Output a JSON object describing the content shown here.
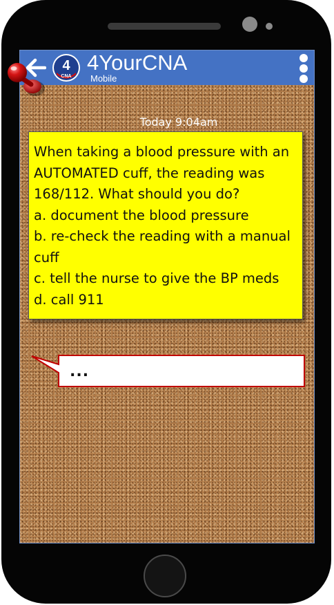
{
  "app": {
    "title": "4YourCNA",
    "subtitle": "Mobile",
    "logo_text": "4",
    "logo_subtext": "CNA"
  },
  "icons": {
    "back": "back-arrow-icon",
    "menu": "kebab-menu-icon",
    "pin": "push-pin-icon"
  },
  "message": {
    "timestamp": "Today 9:04am",
    "lines": [
      "When taking a blood pressure with an",
      "AUTOMATED cuff, the reading was",
      "168/112. What should you do?",
      "a. document the blood pressure",
      "b. re-check the reading with a manual",
      "cuff",
      "c. tell the nurse to give the BP meds",
      "d. call 911"
    ]
  },
  "reply": {
    "text": "..."
  },
  "colors": {
    "appbar": "#4472c4",
    "note": "#ffff00",
    "bubble_border": "#c00000",
    "pin": "#c00000",
    "cork": "#b07a48"
  }
}
